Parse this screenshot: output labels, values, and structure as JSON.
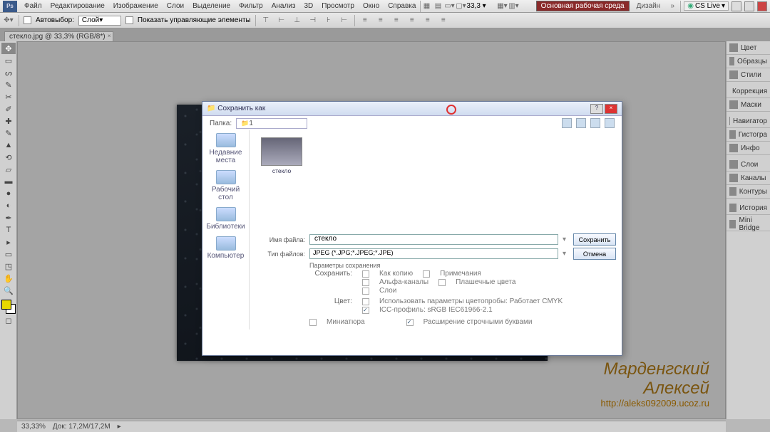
{
  "menubar": [
    "Файл",
    "Редактирование",
    "Изображение",
    "Слои",
    "Выделение",
    "Фильтр",
    "Анализ",
    "3D",
    "Просмотр",
    "Окно",
    "Справка"
  ],
  "topbar": {
    "workspace": "Основная рабочая среда",
    "design": "Дизайн",
    "cslive": "CS Live"
  },
  "optbar": {
    "autoSelectLabel": "Автовыбор:",
    "autoSelectValue": "Слой",
    "showControls": "Показать управляющие элементы",
    "zoomValue": "33,3"
  },
  "doctab": {
    "title": "стекло.jpg @ 33,3% (RGB/8*)"
  },
  "panels": [
    "Цвет",
    "Образцы",
    "Стили",
    "Коррекция",
    "Маски",
    "Навигатор",
    "Гистогра",
    "Инфо",
    "Слои",
    "Каналы",
    "Контуры",
    "История",
    "Mini Bridge"
  ],
  "status": {
    "zoom": "33,33%",
    "docinfo": "Док: 17,2M/17,2M"
  },
  "dialog": {
    "title": "Сохранить как",
    "folderLabel": "Папка:",
    "folderValue": "1",
    "side": [
      "Недавние места",
      "Рабочий стол",
      "Библиотеки",
      "Компьютер"
    ],
    "thumbName": "стекло",
    "fileLabel": "Имя файла:",
    "fileValue": "стекло",
    "typeLabel": "Тип файлов:",
    "typeValue": "JPEG (*.JPG;*.JPEG;*.JPE)",
    "saveBtn": "Сохранить",
    "cancelBtn": "Отмена",
    "optHeader": "Параметры сохранения",
    "saveLabel": "Сохранить:",
    "opts1": [
      "Как копию",
      "Примечания"
    ],
    "opts2": [
      "Альфа-каналы",
      "Плашечные цвета"
    ],
    "opts3": [
      "Слои"
    ],
    "colorLabel": "Цвет:",
    "colorOpts": [
      "Использовать параметры цветопробы: Работает CMYK",
      "ICC-профиль: sRGB IEC61966-2.1"
    ],
    "bottomOpts": [
      "Миниатюра",
      "Расширение строчными буквами"
    ]
  },
  "signature": {
    "line1": "Марденгский",
    "line2": "Алексей",
    "url": "http://aleks092009.ucoz.ru"
  }
}
